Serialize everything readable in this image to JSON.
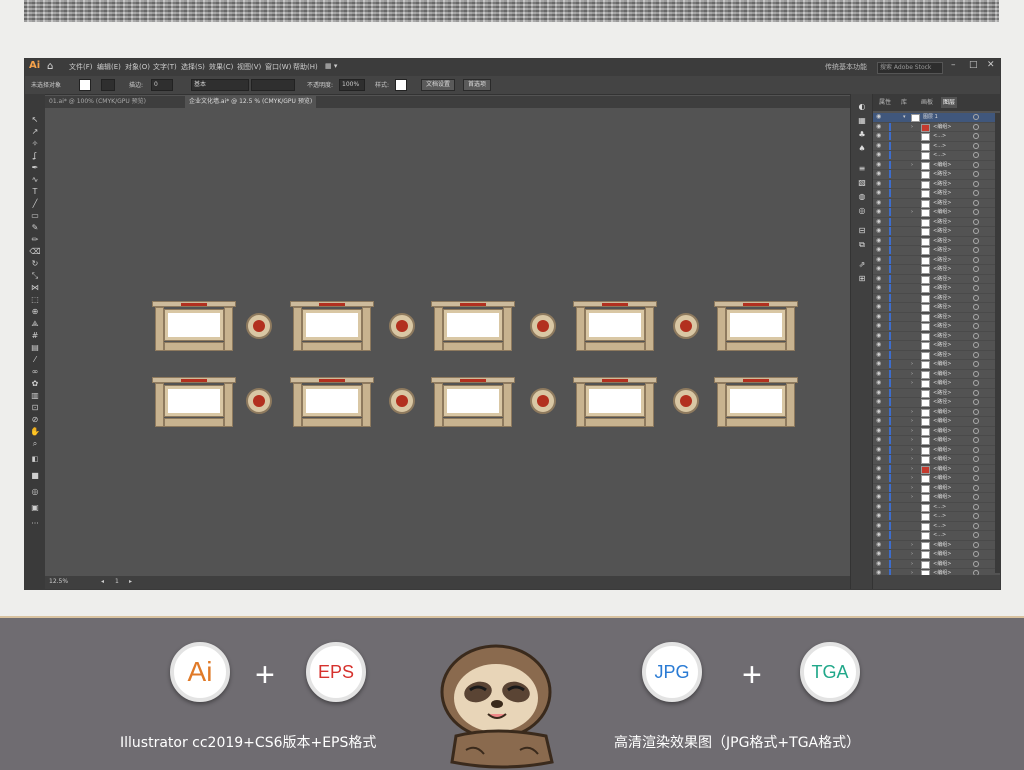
{
  "app": {
    "logo": "Ai",
    "menus": [
      "文件(F)",
      "编辑(E)",
      "对象(O)",
      "文字(T)",
      "选择(S)",
      "效果(C)",
      "视图(V)",
      "窗口(W)",
      "帮助(H)"
    ],
    "workspace": "传统基本功能",
    "search_placeholder": "搜索 Adobe Stock"
  },
  "control_bar": {
    "no_selection": "未选择对象",
    "stroke_label": "描边:",
    "stroke_value": "0",
    "stroke_style": "基本",
    "opacity_label": "不透明度:",
    "opacity_value": "100%",
    "style_label": "样式:",
    "doc_setup": "文档设置",
    "preferences": "首选项"
  },
  "tabs": [
    {
      "label": "01.ai* @ 100% (CMYK/GPU 预览)"
    },
    {
      "label": "企业文化墙.ai* @ 12.5 % (CMYK/GPU 预览)"
    }
  ],
  "status": {
    "zoom": "12.5%",
    "page": "1"
  },
  "layers_panel": {
    "tabs": [
      "属性",
      "库",
      "画板",
      "图层"
    ],
    "active_tab": "图层",
    "top_layer": "图层 1",
    "rows": [
      "<编组>",
      "<...>",
      "<...>",
      "<...>",
      "<编组>",
      "<路径>",
      "<路径>",
      "<路径>",
      "<路径>",
      "<编组>",
      "<路径>",
      "<路径>",
      "<路径>",
      "<路径>",
      "<路径>",
      "<路径>",
      "<路径>",
      "<路径>",
      "<路径>",
      "<路径>",
      "<路径>",
      "<路径>",
      "<路径>",
      "<路径>",
      "<路径>",
      "<编组>",
      "<编组>",
      "<编组>",
      "<路径>",
      "<路径>",
      "<编组>",
      "<编组>",
      "<编组>",
      "<编组>",
      "<编组>",
      "<编组>",
      "<编组>",
      "<编组>",
      "<编组>",
      "<编组>",
      "<...>",
      "<...>",
      "<...>",
      "<...>",
      "<编组>",
      "<编组>",
      "<编组>",
      "<编组>",
      "<编组>",
      "<编组>"
    ]
  },
  "banner": {
    "left_badge_1": "Ai",
    "left_badge_2": "EPS",
    "right_badge_1": "JPG",
    "right_badge_2": "TGA",
    "plus": "+",
    "left_caption": "Illustrator cc2019+CS6版本+EPS格式",
    "right_caption": "高清渲染效果图（JPG格式+TGA格式）"
  },
  "colors": {
    "ai_orange": "#e07a28",
    "eps_red": "#d6322e",
    "jpg_blue": "#2a7bd4",
    "tga_teal": "#21a88a"
  }
}
